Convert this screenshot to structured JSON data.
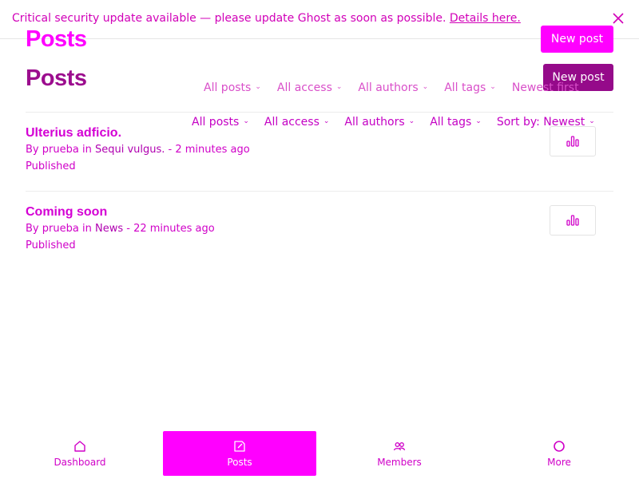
{
  "banner": {
    "message": "Critical security update available — please update Ghost as soon as possible.",
    "link_label": "Details here.",
    "close_icon": "close-icon"
  },
  "header": {
    "title_primary": "Posts",
    "title_secondary": "Posts",
    "new_post_primary": "New post",
    "new_post_secondary": "New post"
  },
  "filters_top": [
    {
      "label": "All posts"
    },
    {
      "label": "All access"
    },
    {
      "label": "All authors"
    },
    {
      "label": "All tags"
    },
    {
      "label": "Newest first"
    }
  ],
  "filters_bottom": [
    {
      "label": "All posts"
    },
    {
      "label": "All access"
    },
    {
      "label": "All authors"
    },
    {
      "label": "All tags"
    },
    {
      "label": "Sort by: Newest"
    }
  ],
  "posts": [
    {
      "title": "Ulterius adficio.",
      "by": "By",
      "author": "prueba",
      "in": "in",
      "tag": "Sequi vulgus.",
      "time": "- 2 minutes ago",
      "status": "Published"
    },
    {
      "title": "Coming soon",
      "by": "By",
      "author": "prueba",
      "in": "in",
      "tag": "News",
      "time": "- 22 minutes ago",
      "status": "Published"
    }
  ],
  "bottom_nav": {
    "dashboard": "Dashboard",
    "posts": "Posts",
    "members": "Members",
    "more": "More"
  },
  "colors": {
    "accent": "#ff00ff",
    "accent_dark": "#950a8a",
    "text": "#d000c8"
  }
}
